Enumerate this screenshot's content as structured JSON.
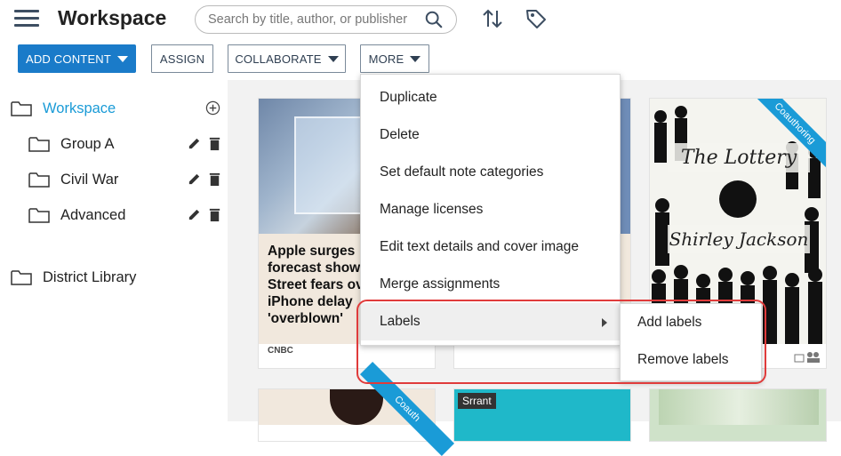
{
  "header": {
    "title": "Workspace",
    "search_placeholder": "Search by title, author, or publisher",
    "menu_icon": "hamburger-icon",
    "sort_icon": "sort-icon",
    "tag_icon": "tag-icon"
  },
  "toolbar": {
    "add_content": "ADD CONTENT",
    "assign": "ASSIGN",
    "collaborate": "COLLABORATE",
    "more": "MORE"
  },
  "sidebar": {
    "root": "Workspace",
    "groups": [
      "Group A",
      "Civil War",
      "Advanced"
    ],
    "library": "District Library"
  },
  "more_menu": {
    "items": [
      "Duplicate",
      "Delete",
      "Set default note categories",
      "Manage licenses",
      "Edit text details and cover image",
      "Merge assignments",
      "Labels"
    ]
  },
  "labels_submenu": {
    "items": [
      "Add labels",
      "Remove labels"
    ]
  },
  "cards": {
    "card1": {
      "headline": "Apple surges forecast show Street fears ov iPhone delay 'overblown'",
      "source": "CNBC"
    },
    "card3": {
      "title": "The Lottery",
      "author": "Shirley Jackson",
      "ribbon": "Coauthoring"
    },
    "card4": {
      "ribbon": "Coauth"
    },
    "card5": {
      "tag": "Srrant"
    }
  },
  "colors": {
    "primary": "#1a7bc9",
    "accent": "#1a9bd7",
    "highlight": "#e03b3b"
  }
}
